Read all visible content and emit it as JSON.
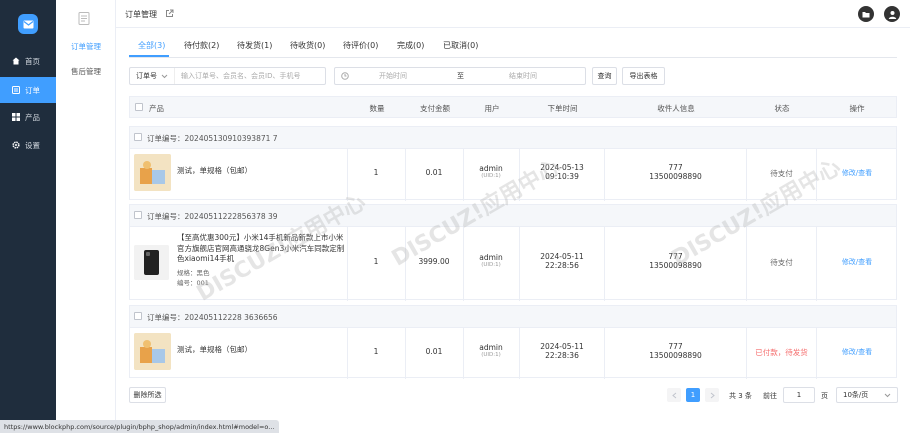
{
  "nav": {
    "items": [
      {
        "label": "首页",
        "icon": "home-icon"
      },
      {
        "label": "订单",
        "icon": "order-icon",
        "active": true
      },
      {
        "label": "产品",
        "icon": "grid-icon"
      },
      {
        "label": "设置",
        "icon": "gear-icon"
      }
    ]
  },
  "subnav": {
    "items": [
      "订单管理",
      "售后管理"
    ]
  },
  "header": {
    "title": "订单管理"
  },
  "tabs": [
    "全部(3)",
    "待付款(2)",
    "待发货(1)",
    "待收货(0)",
    "待评价(0)",
    "完成(0)",
    "已取消(0)"
  ],
  "filters": {
    "select_label": "订单号",
    "search_placeholder": "输入订单号、会员名、会员ID、手机号",
    "start_placeholder": "开始时间",
    "range_sep": "至",
    "end_placeholder": "结束时间",
    "query_btn": "查询",
    "export_btn": "导出表格"
  },
  "table": {
    "headers": [
      "产品",
      "数量",
      "支付金额",
      "用户",
      "下单时间",
      "收件人信息",
      "状态",
      "操作"
    ],
    "order_prefix": "订单编号：",
    "orders": [
      {
        "no": "202405130910393871 7",
        "product": "测试，单规格（包邮）",
        "qty": "1",
        "amount": "0.01",
        "user": "admin",
        "uid": "(UID:1)",
        "date": "2024-05-13",
        "time": "09:10:39",
        "recv_name": "777",
        "recv_phone": "13500098890",
        "status": "待支付",
        "action": "修改/查看"
      },
      {
        "no": "20240511222856378 39",
        "product": "【至高优惠300元】小米14手机新品新款上市小米官方旗舰店官网高通骁龙8Gen3小米汽车同款定制色xiaomi14手机",
        "spec1": "规格：黑色",
        "spec2": "编号：001",
        "qty": "1",
        "amount": "3999.00",
        "user": "admin",
        "uid": "(UID:1)",
        "date": "2024-05-11",
        "time": "22:28:56",
        "recv_name": "777",
        "recv_phone": "13500098890",
        "status": "待支付",
        "action": "修改/查看"
      },
      {
        "no": "202405112228 3636656",
        "product": "测试，单规格（包邮）",
        "qty": "1",
        "amount": "0.01",
        "user": "admin",
        "uid": "(UID:1)",
        "date": "2024-05-11",
        "time": "22:28:36",
        "recv_name": "777",
        "recv_phone": "13500098890",
        "status": "已付款，待发货",
        "action": "修改/查看"
      }
    ]
  },
  "bottom": {
    "delete_btn": "删除所选",
    "current_page": "1",
    "total": "共 3 条",
    "goto_label": "前往",
    "goto_value": "1",
    "page_unit": "页",
    "page_size": "10条/页"
  },
  "status_url": "https://www.blockphp.com/source/plugin/bphp_shop/admin/index.html#model=o...",
  "colors": {
    "accent": "#409eff",
    "sidebar": "#1f2d3d",
    "danger": "#f56c6c"
  }
}
